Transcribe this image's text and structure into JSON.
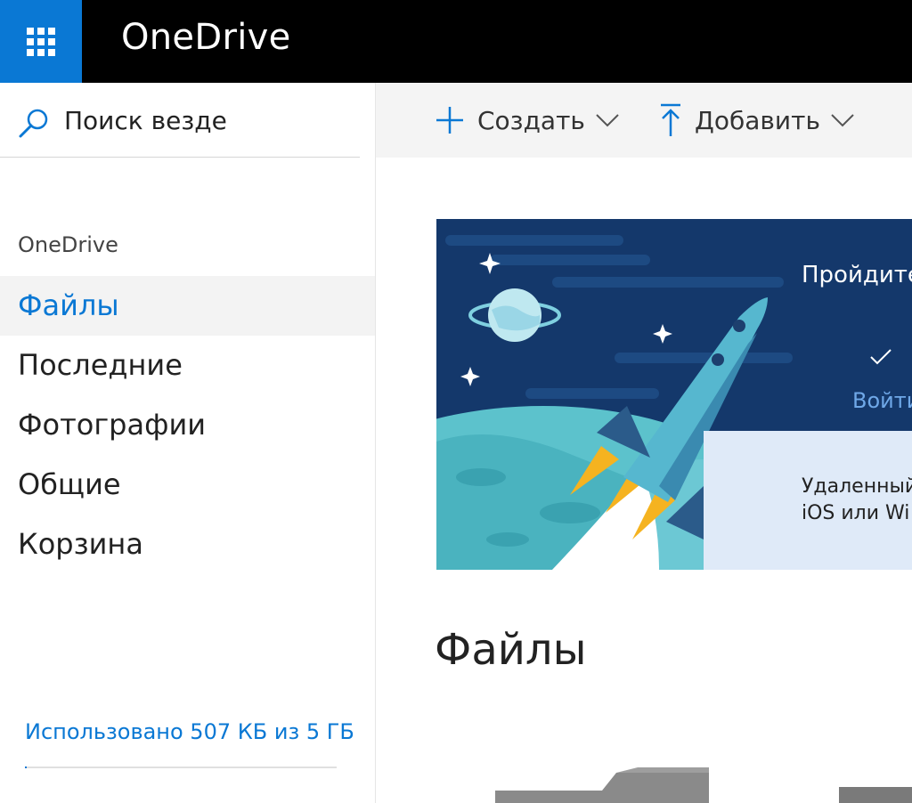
{
  "app": {
    "brand": "OneDrive"
  },
  "search": {
    "text": "Поиск везде"
  },
  "nav": {
    "section_label": "OneDrive",
    "items": [
      {
        "label": "Файлы",
        "active": true
      },
      {
        "label": "Последние",
        "active": false
      },
      {
        "label": "Фотографии",
        "active": false
      },
      {
        "label": "Общие",
        "active": false
      },
      {
        "label": "Корзина",
        "active": false
      }
    ]
  },
  "storage": {
    "text": "Использовано 507 КБ из 5 ГБ",
    "used_fraction": 0.0001
  },
  "commands": {
    "create": "Создать",
    "upload": "Добавить"
  },
  "banner": {
    "heading": "Пройдите",
    "signin": "Войти",
    "desc_line1": "Удаленный",
    "desc_line2": "iOS или Wi"
  },
  "main": {
    "title": "Файлы"
  },
  "colors": {
    "accent": "#0a78d4",
    "banner_bg": "#14386b",
    "topbar": "#000000"
  },
  "icons": {
    "waffle": "waffle-icon",
    "search": "search-icon",
    "create": "plus-icon",
    "upload": "upload-arrow-icon",
    "chevron": "chevron-down-icon",
    "check": "check-icon"
  }
}
